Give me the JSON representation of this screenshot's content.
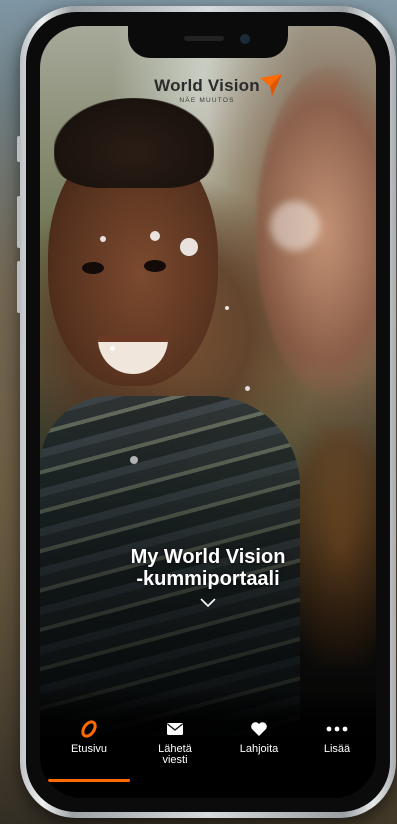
{
  "logo": {
    "name": "World Vision",
    "tagline": "NÄE MUUTOS",
    "icon": "world-vision-star-icon"
  },
  "hero": {
    "title_line1": "My World Vision",
    "title_line2": "-kummiportaali",
    "scroll_icon": "chevron-down-icon"
  },
  "tabs": [
    {
      "label": "Etusivu",
      "icon": "home-leaf-icon",
      "active": true
    },
    {
      "label": "Lähetä viesti",
      "icon": "mail-icon",
      "active": false
    },
    {
      "label": "Lahjoita",
      "icon": "heart-icon",
      "active": false
    },
    {
      "label": "Lisää",
      "icon": "more-icon",
      "active": false
    }
  ],
  "colors": {
    "accent": "#ff6b00",
    "tab_text": "#ffffff"
  }
}
